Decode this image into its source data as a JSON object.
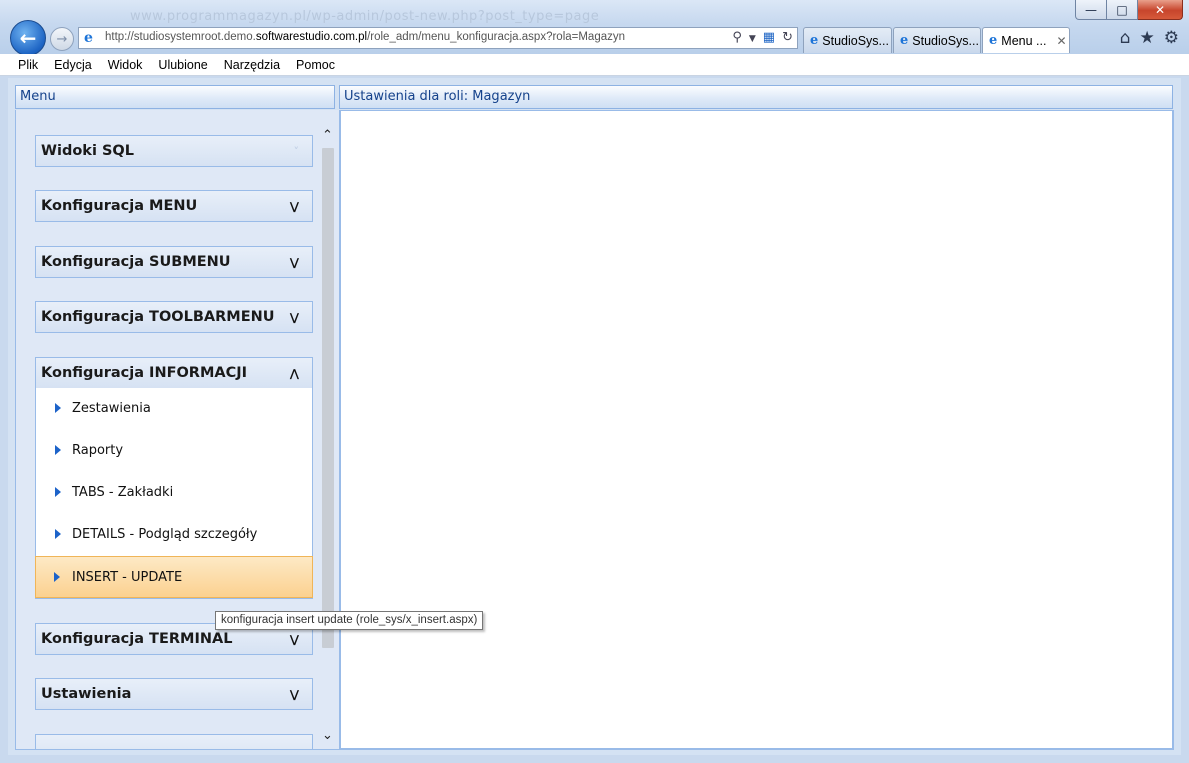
{
  "browser": {
    "ghost_url": "www.programmagazyn.pl/wp-admin/post-new.php?post_type=page",
    "address_url_prefix": "http://studiosystemroot.demo.",
    "address_url_domain": "softwarestudio.com.pl",
    "address_url_suffix": "/role_adm/menu_konfiguracja.aspx?rola=Magazyn",
    "tabs": [
      {
        "label": "StudioSys..."
      },
      {
        "label": "StudioSys..."
      },
      {
        "label": "Menu ..."
      }
    ],
    "window_buttons": {
      "minimize": "—",
      "maximize": "□",
      "close": "✕"
    }
  },
  "menubar": {
    "items": [
      "Plik",
      "Edycja",
      "Widok",
      "Ulubione",
      "Narzędzia",
      "Pomoc"
    ]
  },
  "left_panel": {
    "title": "Menu",
    "sections": [
      {
        "label": "Widoki SQL",
        "state": "disabled"
      },
      {
        "label": "Konfiguracja MENU",
        "state": "collapsed"
      },
      {
        "label": "Konfiguracja SUBMENU",
        "state": "collapsed"
      },
      {
        "label": "Konfiguracja TOOLBARMENU",
        "state": "collapsed"
      },
      {
        "label": "Konfiguracja INFORMACJI",
        "state": "expanded",
        "items": [
          "Zestawienia",
          "Raporty",
          "TABS - Zakładki",
          "DETAILS - Podgląd szczegóły",
          "INSERT - UPDATE"
        ]
      },
      {
        "label": "Konfiguracja TERMINAL",
        "state": "collapsed"
      },
      {
        "label": "Ustawienia",
        "state": "collapsed"
      }
    ],
    "hovered_item": "INSERT - UPDATE"
  },
  "tooltip": "konfiguracja insert update (role_sys/x_insert.aspx)",
  "right_panel": {
    "title": "Ustawienia dla roli: Magazyn"
  },
  "colors": {
    "panel_title_text": "#15428b",
    "panel_border": "#99bbe8",
    "hover_item": "#fbd190"
  }
}
